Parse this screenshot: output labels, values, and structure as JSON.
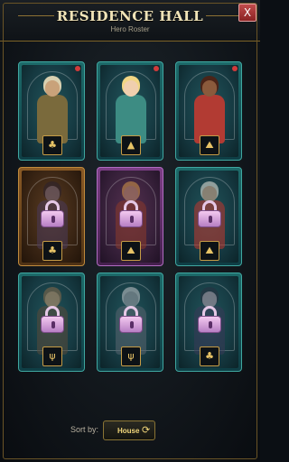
{
  "header": {
    "title": "RESIDENCE HALL",
    "subtitle": "Hero Roster",
    "close_label": "X"
  },
  "heroes": [
    {
      "slot": 1,
      "frame": "teal",
      "locked": false,
      "new_dot": true,
      "emblem_icon": "forest-trees-icon",
      "emblem_glyph": "♣",
      "skin": "#c9a27a",
      "outfit": "#7a6a3c",
      "hair": "#d9d0b0"
    },
    {
      "slot": 2,
      "frame": "teal",
      "locked": false,
      "new_dot": true,
      "emblem_icon": "mountain-peak-icon",
      "emblem_glyph": "▲",
      "skin": "#f0cfae",
      "outfit": "#3d8c83",
      "hair": "#f1d684"
    },
    {
      "slot": 3,
      "frame": "teal",
      "locked": false,
      "new_dot": true,
      "emblem_icon": "mountain-range-icon",
      "emblem_glyph": "⛰",
      "skin": "#8a5a3c",
      "outfit": "#b23b33",
      "hair": "#4b2418"
    },
    {
      "slot": 4,
      "frame": "bronze",
      "locked": true,
      "new_dot": false,
      "emblem_icon": "forest-trees-icon",
      "emblem_glyph": "♣",
      "skin": "#7a6a80",
      "outfit": "#4a3a5a",
      "hair": "#2a2230"
    },
    {
      "slot": 5,
      "frame": "purple",
      "locked": true,
      "new_dot": false,
      "emblem_icon": "mountain-range-icon",
      "emblem_glyph": "⛰",
      "skin": "#c49070",
      "outfit": "#8a3a2a",
      "hair": "#d89a4a"
    },
    {
      "slot": 6,
      "frame": "teal",
      "locked": true,
      "new_dot": false,
      "emblem_icon": "mountain-range-icon",
      "emblem_glyph": "⛰",
      "skin": "#e0b090",
      "outfit": "#c2362e",
      "hair": "#f0ece0"
    },
    {
      "slot": 7,
      "frame": "teal",
      "locked": true,
      "new_dot": false,
      "emblem_icon": "grass-sprout-icon",
      "emblem_glyph": "ψ",
      "skin": "#c89a70",
      "outfit": "#5a4a3a",
      "hair": "#8a6a4a"
    },
    {
      "slot": 8,
      "frame": "teal",
      "locked": true,
      "new_dot": false,
      "emblem_icon": "grass-sprout-icon",
      "emblem_glyph": "ψ",
      "skin": "#a0a0a8",
      "outfit": "#5a6470",
      "hair": "#c8c8cc"
    },
    {
      "slot": 9,
      "frame": "teal",
      "locked": true,
      "new_dot": false,
      "emblem_icon": "forest-trees-icon",
      "emblem_glyph": "♣",
      "skin": "#b8a0b0",
      "outfit": "#3a3a58",
      "hair": "#2a3040"
    }
  ],
  "sort": {
    "label": "Sort by:",
    "value": "House",
    "icon": "refresh-cycle-icon"
  },
  "colors": {
    "accent_gold": "#c59b45",
    "lock_pink": "#f3c9ef",
    "new_dot_red": "#d23b3b"
  }
}
